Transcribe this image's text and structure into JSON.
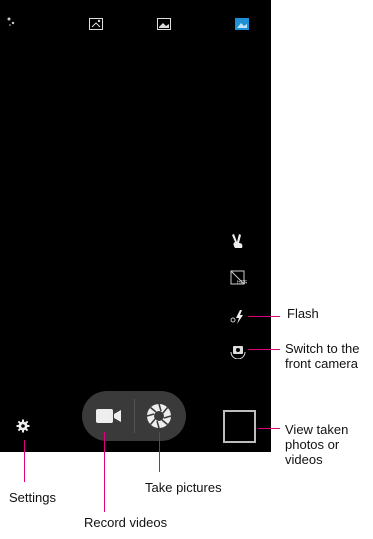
{
  "camera": {
    "top_icons": [
      "sparkle-icon",
      "collage-icon",
      "landscape-icon",
      "scene-icon"
    ],
    "side_icons": [
      "gesture-icon",
      "hdr-off-icon",
      "flash-icon",
      "switch-camera-icon"
    ],
    "bottom_controls": [
      "settings-icon",
      "record-video-button",
      "take-picture-button",
      "thumbnail"
    ],
    "accent_color": "#1e90d6",
    "callout_color": "#e0007a"
  },
  "callouts": {
    "flash": "Flash",
    "switch_line1": "Switch to the",
    "switch_line2": "front camera",
    "view_line1": "View taken",
    "view_line2": "photos or",
    "view_line3": "videos",
    "settings": "Settings",
    "take_pictures": "Take pictures",
    "record_videos": "Record videos"
  }
}
